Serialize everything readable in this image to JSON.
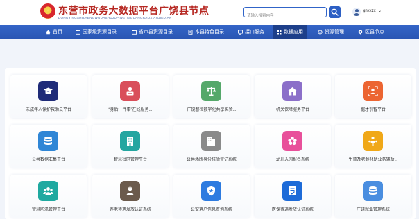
{
  "header": {
    "title": "东营市政务大数据平台广饶县节点",
    "subtitle": "DONGYINGSHIZHENGWUDASHUJUPINGTAIGUANGRAOXIANJIEDIAN",
    "search_placeholder": "请输入搜索内容",
    "username": "gnxxzx",
    "caret": "⌄"
  },
  "nav": {
    "items": [
      {
        "label": "首页",
        "icon": "home-icon"
      },
      {
        "label": "国家级资源目录",
        "icon": "folder-icon"
      },
      {
        "label": "省市县资源目录",
        "icon": "folder-icon"
      },
      {
        "label": "本县特色目录",
        "icon": "book-icon"
      },
      {
        "label": "接口服务",
        "icon": "api-icon"
      },
      {
        "label": "数据应用",
        "icon": "grid-icon"
      },
      {
        "label": "资源管理",
        "icon": "manage-icon"
      },
      {
        "label": "区县节点",
        "icon": "location-icon"
      }
    ],
    "active_index": 5
  },
  "apps": [
    {
      "label": "未成年人保护救助云平台",
      "color": "#1f2b78",
      "icon": "graduation-cap-icon"
    },
    {
      "label": "“身后一件事”在线服务...",
      "color": "#d94e5a",
      "icon": "person-card-icon"
    },
    {
      "label": "广饶智检数字化共享实验...",
      "color": "#55a86a",
      "icon": "scales-icon"
    },
    {
      "label": "机关保障服务平台",
      "color": "#8b6fc9",
      "icon": "building-home-icon"
    },
    {
      "label": "据才引智平台",
      "color": "#ec6532",
      "icon": "scan-person-icon"
    },
    {
      "label": "公共数据汇集平台",
      "color": "#2f86d6",
      "icon": "database-icon"
    },
    {
      "label": "智慧社区管理平台",
      "color": "#24a6a0",
      "icon": "building-icon"
    },
    {
      "label": "公共场所身份核验登记系统",
      "color": "#8a8a8a",
      "icon": "office-building-icon"
    },
    {
      "label": "幼儿入园报名系统",
      "color": "#e8509a",
      "icon": "flower-icon"
    },
    {
      "label": "生育及老龄补助业务辅助...",
      "color": "#f0a818",
      "icon": "family-icon"
    },
    {
      "label": "智慧防汛管理平台",
      "color": "#1fa9a0",
      "icon": "team-icon"
    },
    {
      "label": "养老待遇发放认证系统",
      "color": "#6b5a4c",
      "icon": "elder-icon"
    },
    {
      "label": "公安落户信息查询系统",
      "color": "#2d7be0",
      "icon": "police-shield-icon"
    },
    {
      "label": "医保待遇发放认证系统",
      "color": "#1d6bd8",
      "icon": "document-check-icon"
    },
    {
      "label": "广饶就业管理系统",
      "color": "#4a8ee0",
      "icon": "database-stack-icon"
    }
  ]
}
